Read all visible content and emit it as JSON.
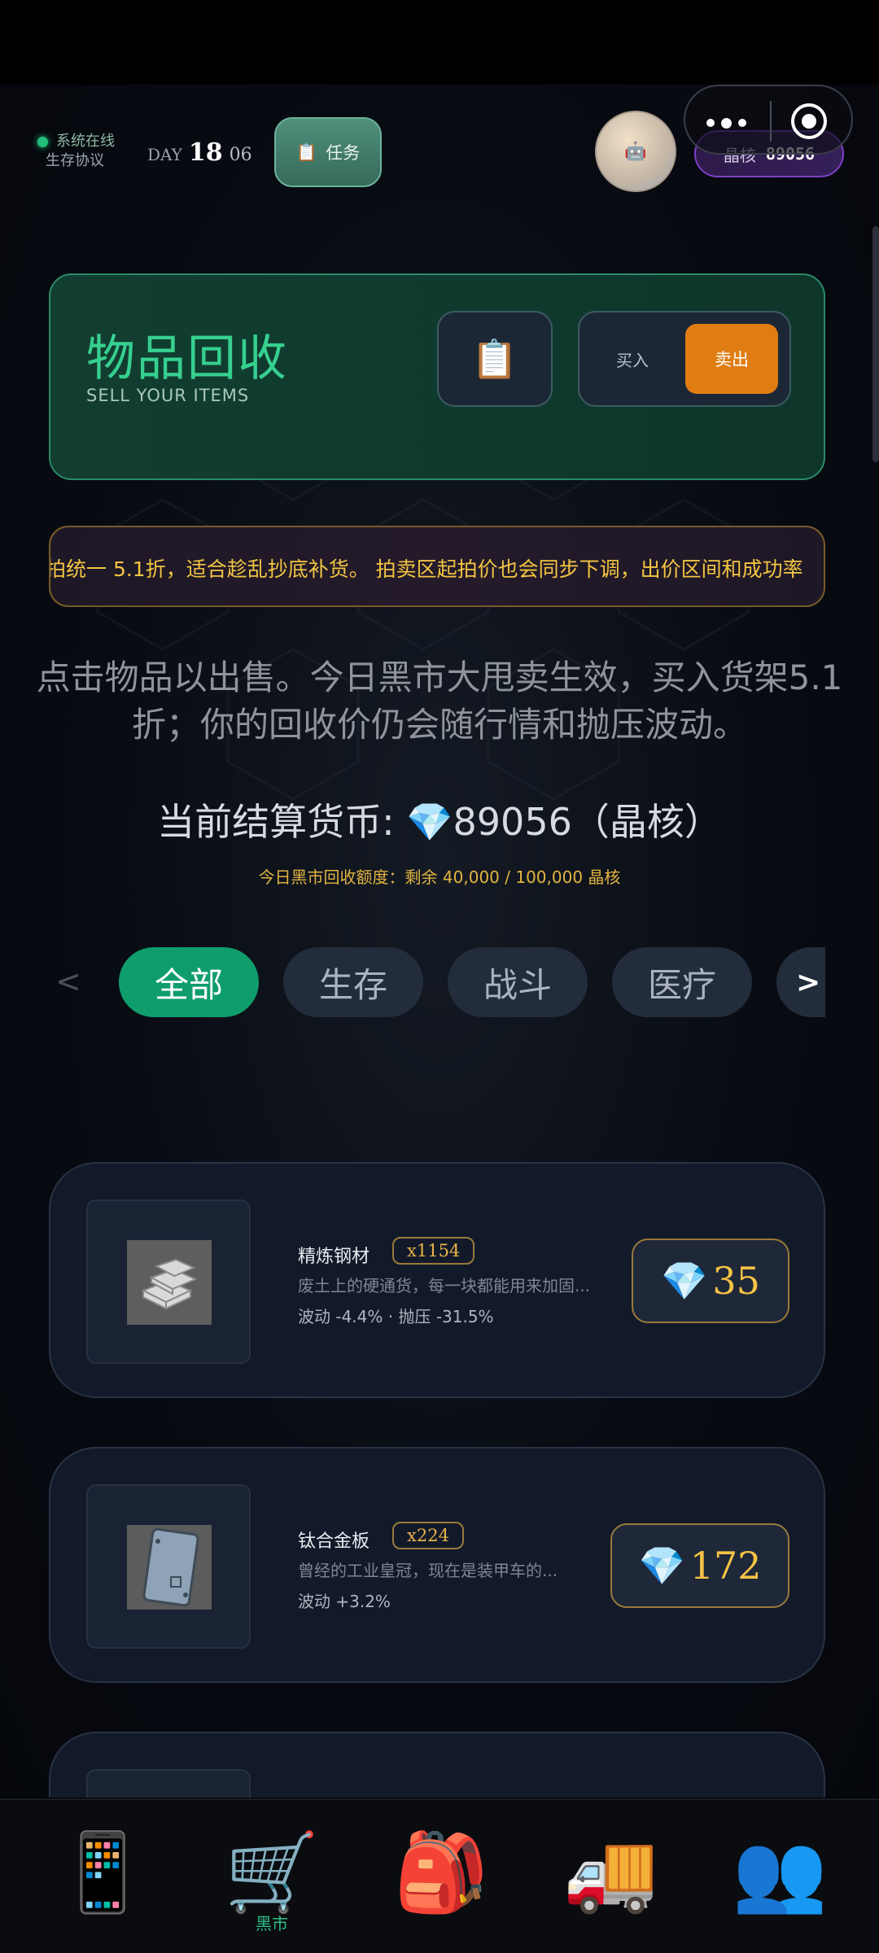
{
  "status": {
    "online_label": "系统在线",
    "protocol_label": "生存协议",
    "day_label": "DAY",
    "day_number": "18",
    "day_sub": "06",
    "task_button": "任务",
    "task_icon": "clipboard-icon",
    "avatar_icon": "robot-face-icon",
    "crystal_label": "晶核",
    "crystal_value": "89056",
    "online_color": "#22c07a"
  },
  "header": {
    "title": "物品回收",
    "subtitle": "SELL YOUR ITEMS",
    "clipboard_icon": "📋",
    "buy_label": "买入",
    "sell_label": "卖出",
    "accent": "#36d08f",
    "sell_color": "#e07d12"
  },
  "marquee": {
    "text": "拍统一 5.1折，适合趁乱抄底补货。 拍卖区起拍价也会同步下调，出价区间和成功率"
  },
  "notice": {
    "text": "点击物品以出售。今日黑市大甩卖生效，买入货架5.1折；你的回收价仍会随行情和抛压波动。"
  },
  "balance": {
    "text": "当前结算货币: 💎89056（晶核）"
  },
  "quota": {
    "text": "今日黑市回收额度：剩余 40,000 / 100,000 晶核"
  },
  "tabs": {
    "left_arrow": "<",
    "items": [
      "全部",
      "生存",
      "战斗",
      "医疗"
    ],
    "more_label": ">"
  },
  "items": [
    {
      "name": "精炼钢材",
      "qty": "x1154",
      "desc": "废土上的硬通货，每一块都能用来加固...",
      "stats": "波动 -4.4% · 抛压 -31.5%",
      "price": "35",
      "icon": "steel-ingots-icon"
    },
    {
      "name": "钛合金板",
      "qty": "x224",
      "desc": "曾经的工业皇冠，现在是装甲车的...",
      "stats": "波动 +3.2%",
      "price": "172",
      "icon": "titanium-plate-icon"
    }
  ],
  "nav": {
    "items": [
      {
        "icon": "📱",
        "label": ""
      },
      {
        "icon": "🛒",
        "label": "黑市"
      },
      {
        "icon": "🎒",
        "label": ""
      },
      {
        "icon": "🚚",
        "label": ""
      },
      {
        "icon": "👥",
        "label": ""
      }
    ]
  },
  "gem_icon": "💎"
}
